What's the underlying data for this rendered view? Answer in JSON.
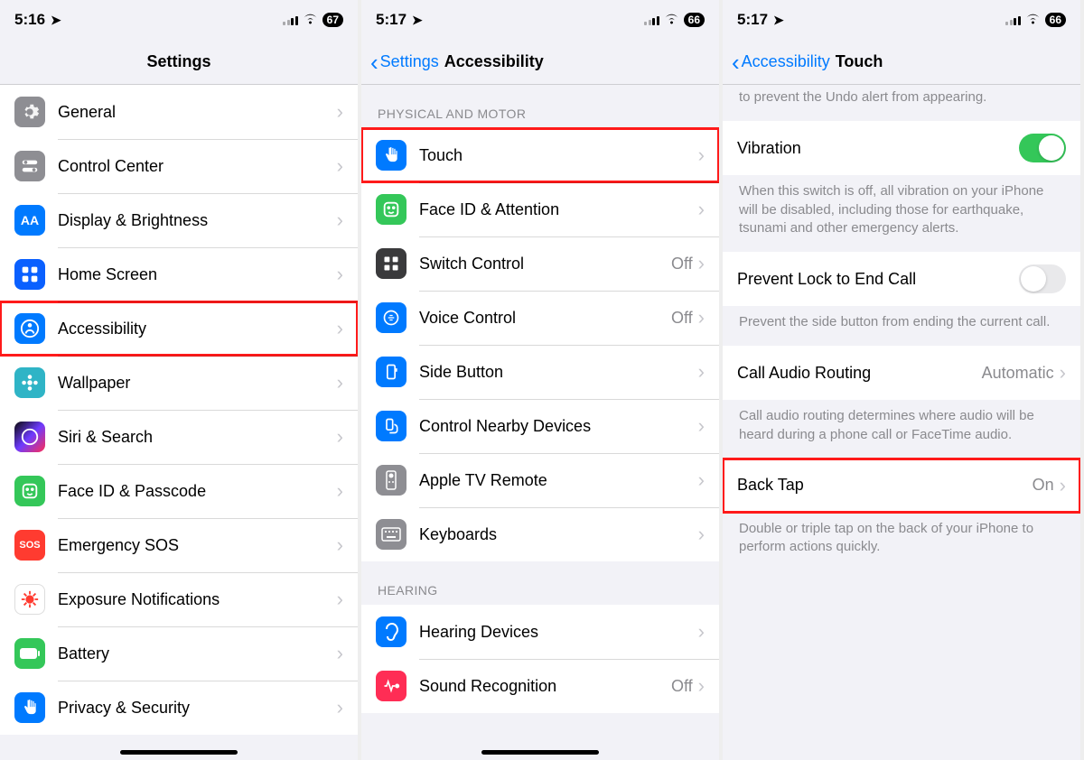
{
  "screen1": {
    "time": "5:16",
    "battery": "67",
    "title": "Settings",
    "items": [
      {
        "label": "General",
        "icon": "gear",
        "bg": "i-gray"
      },
      {
        "label": "Control Center",
        "icon": "toggles",
        "bg": "i-gray"
      },
      {
        "label": "Display & Brightness",
        "icon": "AA",
        "bg": "i-blue"
      },
      {
        "label": "Home Screen",
        "icon": "grid",
        "bg": "i-db"
      },
      {
        "label": "Accessibility",
        "icon": "person",
        "bg": "i-blue",
        "hl": true
      },
      {
        "label": "Wallpaper",
        "icon": "flower",
        "bg": "i-cyan"
      },
      {
        "label": "Siri & Search",
        "icon": "siri",
        "bg": "i-grad"
      },
      {
        "label": "Face ID & Passcode",
        "icon": "face",
        "bg": "i-green"
      },
      {
        "label": "Emergency SOS",
        "icon": "SOS",
        "bg": "i-redsos"
      },
      {
        "label": "Exposure Notifications",
        "icon": "virus",
        "bg": "i-white"
      },
      {
        "label": "Battery",
        "icon": "batt",
        "bg": "i-green"
      },
      {
        "label": "Privacy & Security",
        "icon": "hand",
        "bg": "i-blue"
      }
    ]
  },
  "screen2": {
    "time": "5:17",
    "battery": "66",
    "back": "Settings",
    "title": "Accessibility",
    "section1": "Physical and Motor",
    "items1": [
      {
        "label": "Touch",
        "icon": "hand",
        "bg": "i-blue",
        "hl": true
      },
      {
        "label": "Face ID & Attention",
        "icon": "face",
        "bg": "i-green"
      },
      {
        "label": "Switch Control",
        "icon": "switch",
        "bg": "i-dark",
        "value": "Off"
      },
      {
        "label": "Voice Control",
        "icon": "voice",
        "bg": "i-blue",
        "value": "Off"
      },
      {
        "label": "Side Button",
        "icon": "side",
        "bg": "i-blue"
      },
      {
        "label": "Control Nearby Devices",
        "icon": "nearby",
        "bg": "i-blue"
      },
      {
        "label": "Apple TV Remote",
        "icon": "remote",
        "bg": "i-gray"
      },
      {
        "label": "Keyboards",
        "icon": "kb",
        "bg": "i-gray"
      }
    ],
    "section2": "Hearing",
    "items2": [
      {
        "label": "Hearing Devices",
        "icon": "ear",
        "bg": "i-blue"
      },
      {
        "label": "Sound Recognition",
        "icon": "wave",
        "bg": "i-pink",
        "value": "Off"
      }
    ]
  },
  "screen3": {
    "time": "5:17",
    "battery": "66",
    "back": "Accessibility",
    "title": "Touch",
    "cut_desc": "to prevent the Undo alert from appearing.",
    "vibration": {
      "label": "Vibration",
      "on": true,
      "desc": "When this switch is off, all vibration on your iPhone will be disabled, including those for earthquake, tsunami and other emergency alerts."
    },
    "prevent": {
      "label": "Prevent Lock to End Call",
      "on": false,
      "desc": "Prevent the side button from ending the current call."
    },
    "routing": {
      "label": "Call Audio Routing",
      "value": "Automatic",
      "desc": "Call audio routing determines where audio will be heard during a phone call or FaceTime audio."
    },
    "backtap": {
      "label": "Back Tap",
      "value": "On",
      "desc": "Double or triple tap on the back of your iPhone to perform actions quickly.",
      "hl": true
    }
  }
}
